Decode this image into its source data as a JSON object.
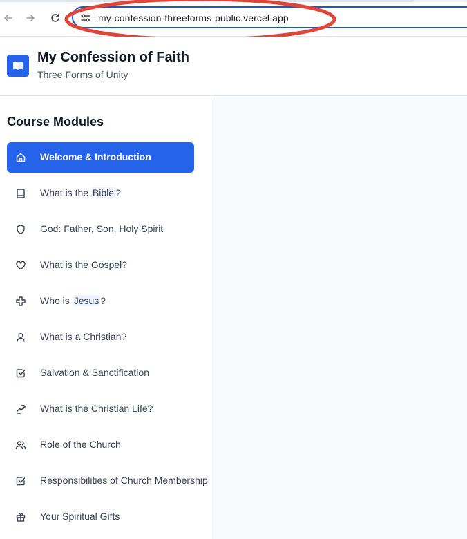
{
  "browser": {
    "url": "my-confession-threeforms-public.vercel.app"
  },
  "app": {
    "title": "My Confession of Faith",
    "subtitle": "Three Forms of Unity",
    "logo_icon": "open-book-icon",
    "brand_color": "#2563eb"
  },
  "sidebar": {
    "heading": "Course Modules",
    "items": [
      {
        "label": "Welcome & Introduction",
        "icon": "home-icon",
        "active": true
      },
      {
        "label_pre": "What is the ",
        "label_hl": "Bible",
        "label_post": "?",
        "icon": "book-icon"
      },
      {
        "label": "God: Father, Son, Holy Spirit",
        "icon": "shield-icon"
      },
      {
        "label": "What is the Gospel?",
        "icon": "heart-icon"
      },
      {
        "label_pre": "Who is ",
        "label_hl": "Jesus",
        "label_post": "?",
        "icon": "cross-icon"
      },
      {
        "label": "What is a Christian?",
        "icon": "user-icon"
      },
      {
        "label": "Salvation & Sanctification",
        "icon": "check-square-icon"
      },
      {
        "label": "What is the Christian Life?",
        "icon": "hand-heart-icon"
      },
      {
        "label": "Role of the Church",
        "icon": "users-icon"
      },
      {
        "label": "Responsibilities of Church Membership",
        "icon": "check-square-icon"
      },
      {
        "label": "Your Spiritual Gifts",
        "icon": "gift-icon"
      }
    ]
  }
}
